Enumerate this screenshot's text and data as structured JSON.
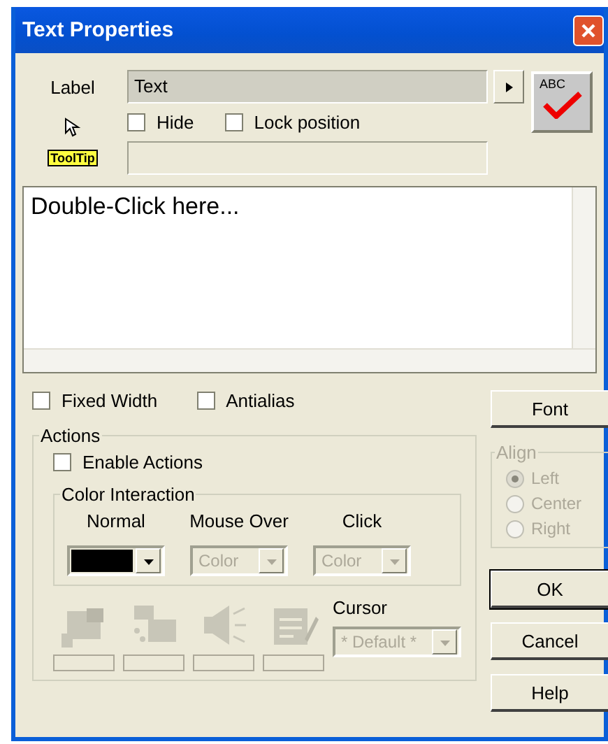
{
  "window": {
    "title": "Text Properties"
  },
  "label": {
    "caption": "Label",
    "value": "Text"
  },
  "options": [
    {
      "label": "Hide",
      "checked": false
    },
    {
      "label": "Lock position",
      "checked": false
    }
  ],
  "tooltip": {
    "badge": "ToolTip"
  },
  "editor": {
    "text": "Double-Click here..."
  },
  "text_options": [
    {
      "label": "Fixed Width",
      "checked": false
    },
    {
      "label": "Antialias",
      "checked": false
    }
  ],
  "actions": {
    "title": "Actions",
    "enable": {
      "label": "Enable Actions",
      "checked": false
    },
    "color_interaction": {
      "title": "Color Interaction",
      "columns": [
        {
          "label": "Normal",
          "color": "#000000",
          "disabled": false
        },
        {
          "label": "Mouse Over",
          "value": "Color",
          "disabled": true
        },
        {
          "label": "Click",
          "value": "Color",
          "disabled": true
        }
      ]
    },
    "cursor": {
      "label": "Cursor",
      "value": "* Default *",
      "disabled": true
    }
  },
  "spellcheck_button": "ABC",
  "font_button": "Font",
  "align": {
    "title": "Align",
    "disabled": true,
    "options": [
      {
        "label": "Left",
        "selected": true
      },
      {
        "label": "Center",
        "selected": false
      },
      {
        "label": "Right",
        "selected": false
      }
    ]
  },
  "buttons": [
    "OK",
    "Cancel",
    "Help"
  ]
}
